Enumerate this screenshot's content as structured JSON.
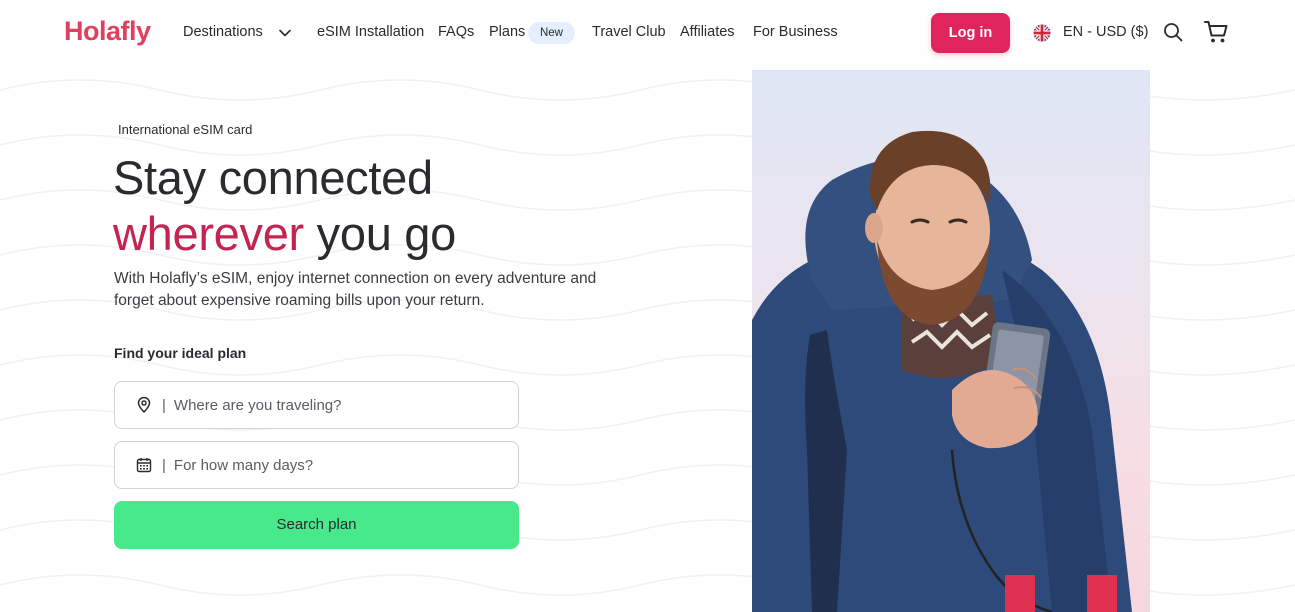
{
  "brand": {
    "name": "Holafly",
    "color": "#e0405f"
  },
  "nav": {
    "items": [
      {
        "label": "Destinations"
      },
      {
        "label": "eSIM Installation"
      },
      {
        "label": "FAQs"
      },
      {
        "label": "Plans"
      },
      {
        "label": "Travel Club"
      },
      {
        "label": "Affiliates"
      },
      {
        "label": "For Business"
      }
    ],
    "plans_badge": "New",
    "login": "Log in",
    "language": "EN - USD ($)"
  },
  "hero": {
    "eyebrow": "International eSIM card",
    "headline_line1": "Stay connected",
    "headline_accent": "wherever",
    "headline_rest": " you go",
    "lead": "With Holafly’s eSIM, enjoy internet connection on every adventure and forget about expensive roaming bills upon your return.",
    "find_label": "Find your ideal plan",
    "destination_placeholder": "Where are you traveling?",
    "days_placeholder": "For how many days?",
    "search_button": "Search plan"
  },
  "icons": {
    "chevron": "chevron-down-icon",
    "flag": "uk-flag-icon",
    "search": "search-icon",
    "cart": "cart-icon",
    "location": "location-pin-icon",
    "calendar": "calendar-icon"
  },
  "colors": {
    "accent": "#c4244f",
    "login_bg": "#e0245e",
    "cta_bg": "#48e98b",
    "badge_bg": "#e4eefc"
  }
}
